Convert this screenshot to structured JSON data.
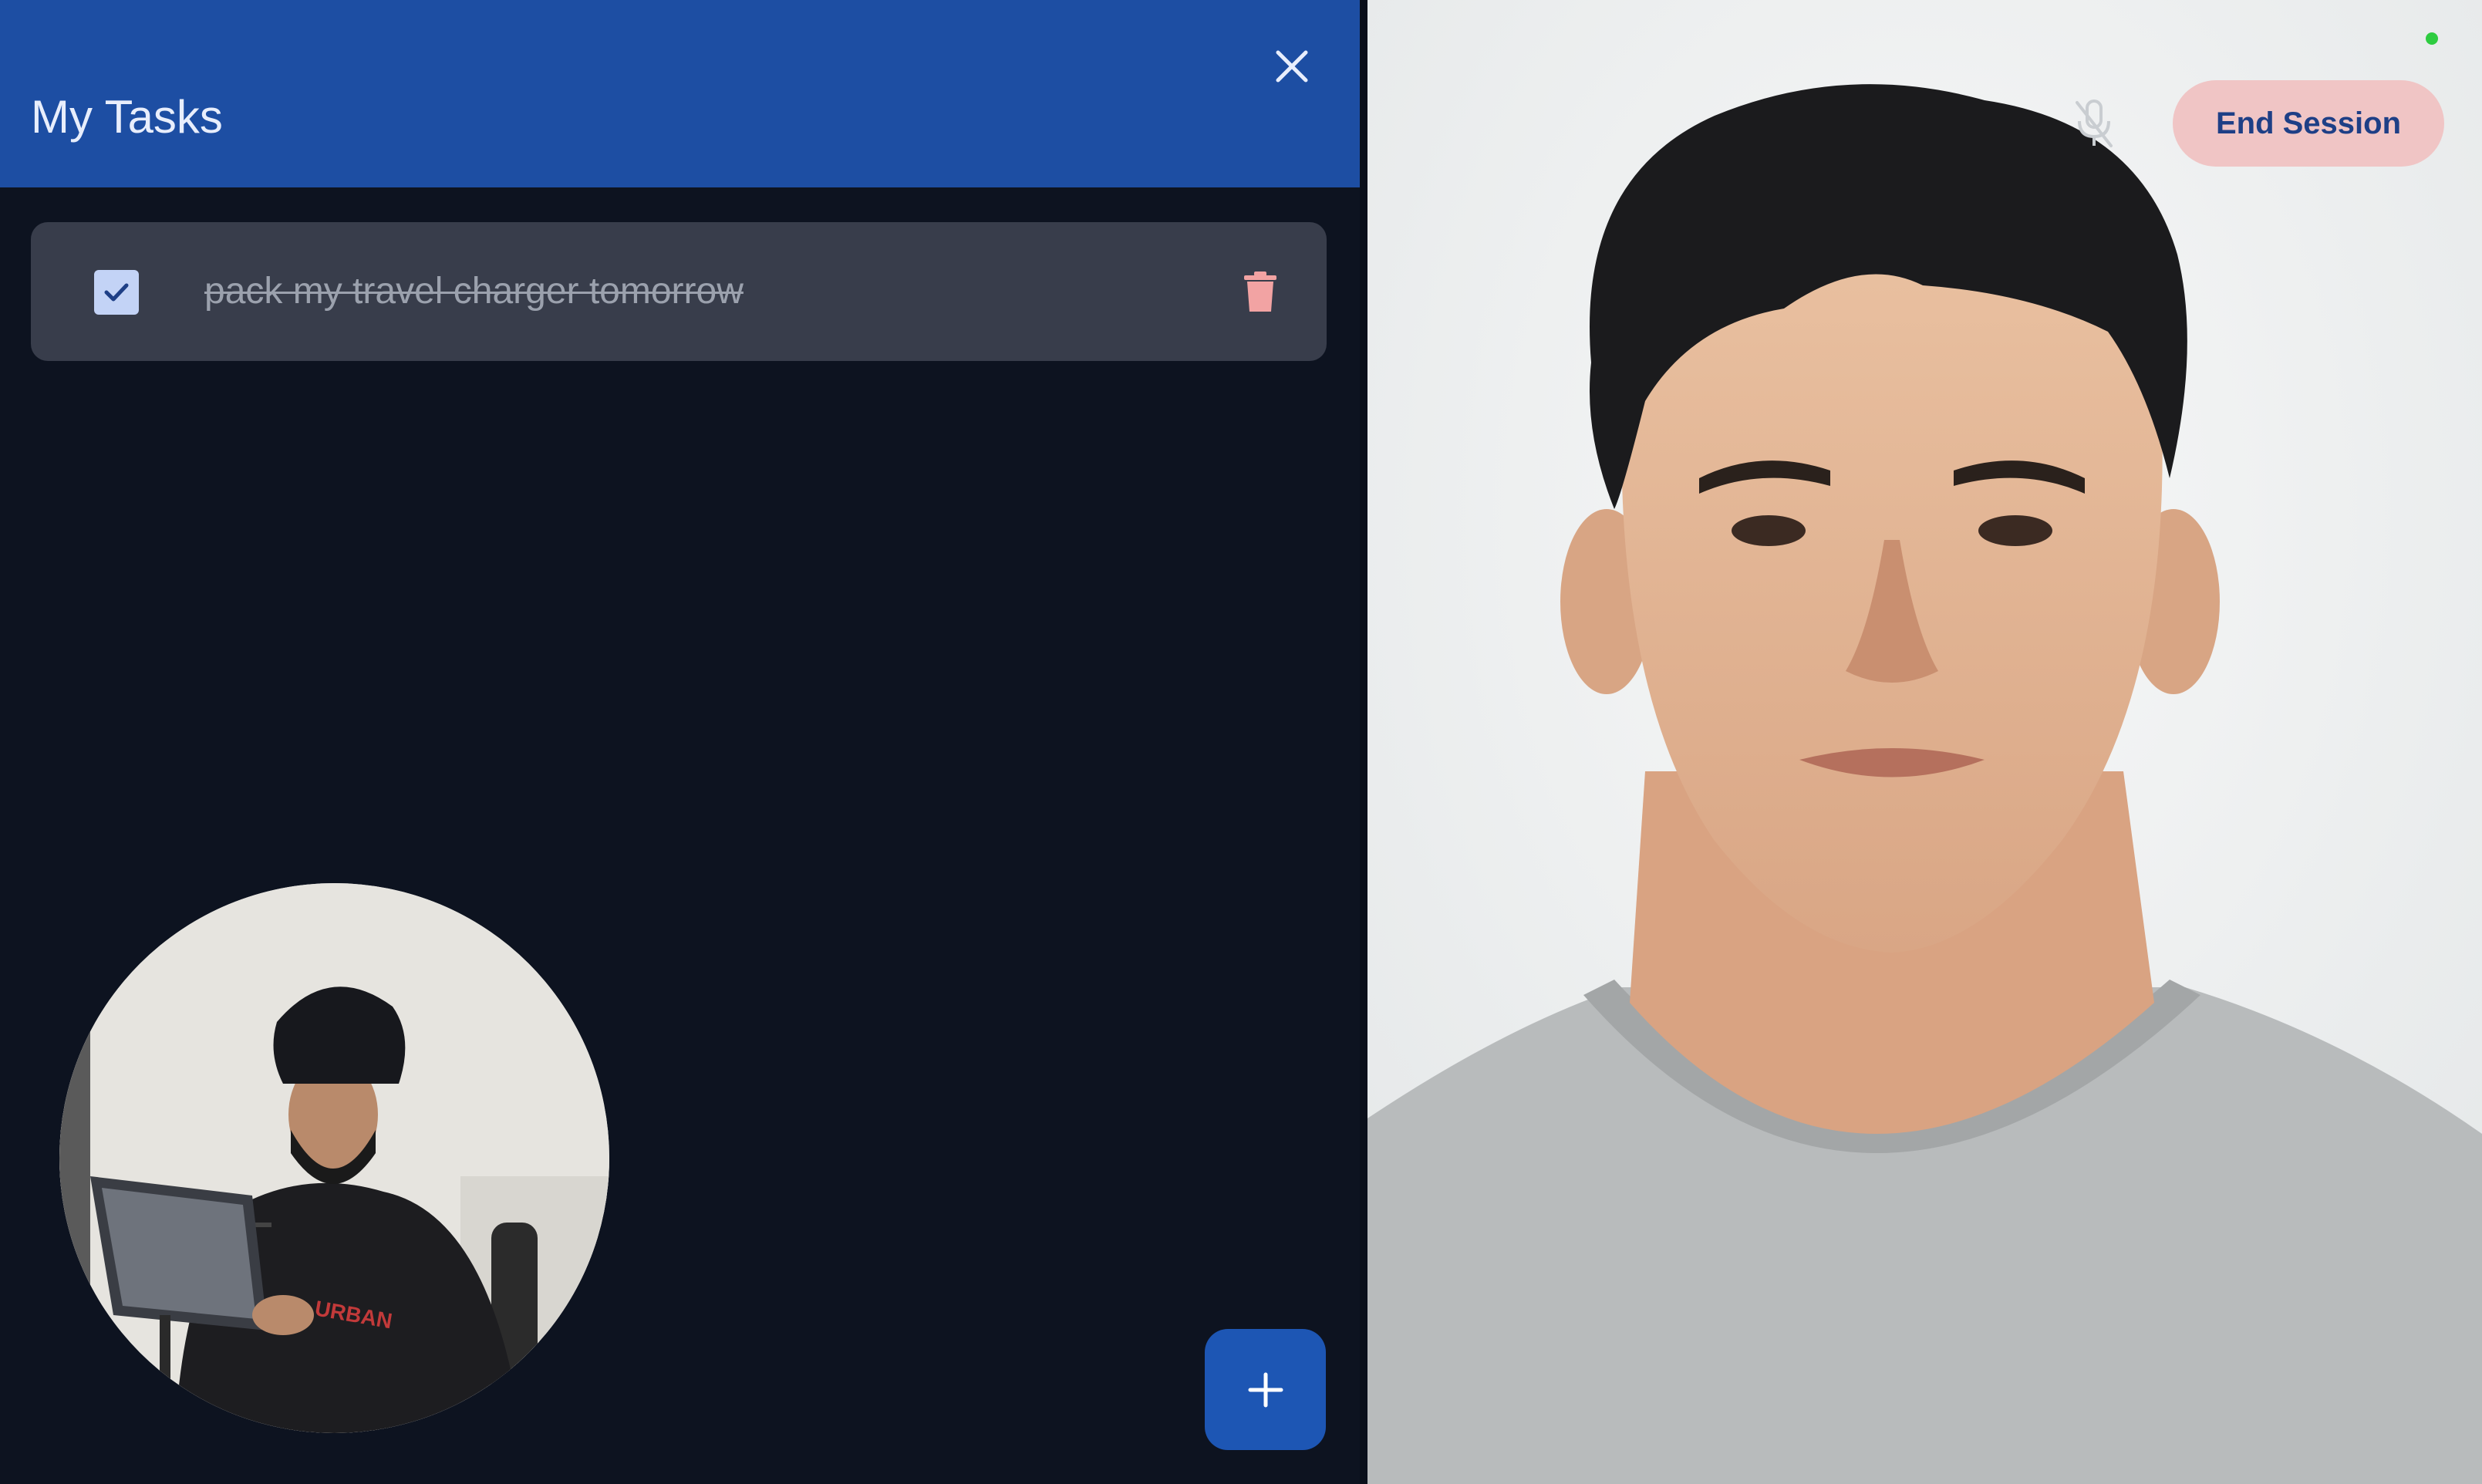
{
  "panel": {
    "title": "My Tasks",
    "tasks": [
      {
        "text": "pack my travel charger tomorrow",
        "completed": true
      }
    ]
  },
  "call": {
    "end_session_label": "End Session",
    "mic_muted": true,
    "status_color": "#2ecc40"
  },
  "colors": {
    "header": "#1d4ea3",
    "panel_bg": "#0d1320",
    "task_card": "#383d4b",
    "accent_button": "#1d56b4",
    "end_session_bg": "#f0c5c5",
    "delete_icon": "#f2a3a3"
  },
  "icons": {
    "close": "close-icon",
    "checkbox": "checkmark-icon",
    "delete": "trash-icon",
    "add": "plus-icon",
    "mic": "mic-off-icon"
  }
}
